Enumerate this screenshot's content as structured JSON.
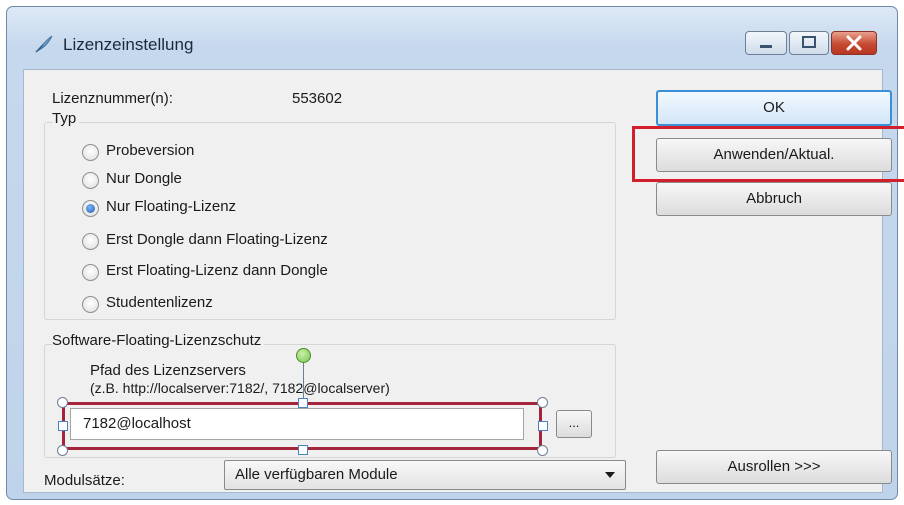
{
  "window": {
    "title": "Lizenzeinstellung"
  },
  "license": {
    "label": "Lizenznummer(n):",
    "value": "553602"
  },
  "type_group": {
    "legend": "Typ",
    "options": [
      {
        "label": "Probeversion",
        "checked": false
      },
      {
        "label": "Nur Dongle",
        "checked": false
      },
      {
        "label": "Nur Floating-Lizenz",
        "checked": true
      },
      {
        "label": "Erst Dongle dann Floating-Lizenz",
        "checked": false
      },
      {
        "label": "Erst Floating-Lizenz dann Dongle",
        "checked": false
      },
      {
        "label": "Studentenlizenz",
        "checked": false
      }
    ]
  },
  "floating_group": {
    "legend": "Software-Floating-Lizenzschutz",
    "path_label": "Pfad des Lizenzservers",
    "path_hint": "(z.B. http://localserver:7182/, 7182@localserver)",
    "path_value": "7182@localhost",
    "browse_label": "..."
  },
  "modules": {
    "label": "Modulsätze:",
    "selected": "Alle verfügbaren Module"
  },
  "buttons": {
    "ok": "OK",
    "apply": "Anwenden/Aktual.",
    "cancel": "Abbruch",
    "expand": "Ausrollen >>>"
  },
  "colors": {
    "highlight": "#d21f2b",
    "selection": "#a3243b",
    "handle_green": "#78c850"
  }
}
